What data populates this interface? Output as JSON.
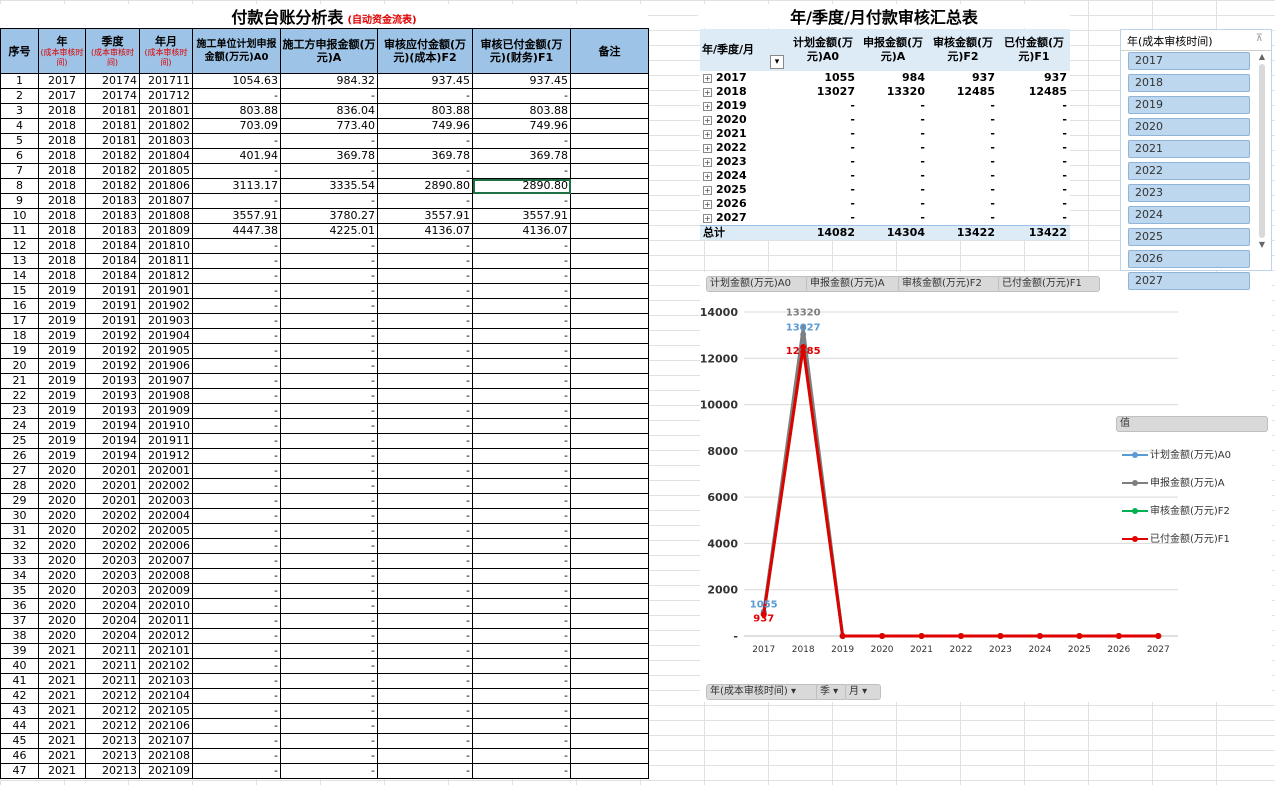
{
  "ledger": {
    "title": "付款台账分析表",
    "subtitle": "(自动资金流表)",
    "headers": {
      "seq": "序号",
      "year": "年",
      "year_sub": "(成本审核时间)",
      "quarter": "季度",
      "quarter_sub": "(成本审核时间)",
      "month": "年月",
      "month_sub": "(成本审核时间)",
      "a0": "施工单位计划申报金额(万元)A0",
      "a": "施工方申报金额(万元)A",
      "f2": "审核应付金额(万元)(成本)F2",
      "f1": "审核已付金额(万元)(财务)F1",
      "note": "备注"
    },
    "rows": [
      [
        "1",
        "2017",
        "20174",
        "201711",
        "1054.63",
        "984.32",
        "937.45",
        "937.45"
      ],
      [
        "2",
        "2017",
        "20174",
        "201712",
        "-",
        "-",
        "-",
        "-"
      ],
      [
        "3",
        "2018",
        "20181",
        "201801",
        "803.88",
        "836.04",
        "803.88",
        "803.88"
      ],
      [
        "4",
        "2018",
        "20181",
        "201802",
        "703.09",
        "773.40",
        "749.96",
        "749.96"
      ],
      [
        "5",
        "2018",
        "20181",
        "201803",
        "-",
        "-",
        "-",
        "-"
      ],
      [
        "6",
        "2018",
        "20182",
        "201804",
        "401.94",
        "369.78",
        "369.78",
        "369.78"
      ],
      [
        "7",
        "2018",
        "20182",
        "201805",
        "-",
        "-",
        "-",
        "-"
      ],
      [
        "8",
        "2018",
        "20182",
        "201806",
        "3113.17",
        "3335.54",
        "2890.80",
        "2890.80"
      ],
      [
        "9",
        "2018",
        "20183",
        "201807",
        "-",
        "-",
        "-",
        "-"
      ],
      [
        "10",
        "2018",
        "20183",
        "201808",
        "3557.91",
        "3780.27",
        "3557.91",
        "3557.91"
      ],
      [
        "11",
        "2018",
        "20183",
        "201809",
        "4447.38",
        "4225.01",
        "4136.07",
        "4136.07"
      ],
      [
        "12",
        "2018",
        "20184",
        "201810",
        "-",
        "-",
        "-",
        "-"
      ],
      [
        "13",
        "2018",
        "20184",
        "201811",
        "-",
        "-",
        "-",
        "-"
      ],
      [
        "14",
        "2018",
        "20184",
        "201812",
        "-",
        "-",
        "-",
        "-"
      ],
      [
        "15",
        "2019",
        "20191",
        "201901",
        "-",
        "-",
        "-",
        "-"
      ],
      [
        "16",
        "2019",
        "20191",
        "201902",
        "-",
        "-",
        "-",
        "-"
      ],
      [
        "17",
        "2019",
        "20191",
        "201903",
        "-",
        "-",
        "-",
        "-"
      ],
      [
        "18",
        "2019",
        "20192",
        "201904",
        "-",
        "-",
        "-",
        "-"
      ],
      [
        "19",
        "2019",
        "20192",
        "201905",
        "-",
        "-",
        "-",
        "-"
      ],
      [
        "20",
        "2019",
        "20192",
        "201906",
        "-",
        "-",
        "-",
        "-"
      ],
      [
        "21",
        "2019",
        "20193",
        "201907",
        "-",
        "-",
        "-",
        "-"
      ],
      [
        "22",
        "2019",
        "20193",
        "201908",
        "-",
        "-",
        "-",
        "-"
      ],
      [
        "23",
        "2019",
        "20193",
        "201909",
        "-",
        "-",
        "-",
        "-"
      ],
      [
        "24",
        "2019",
        "20194",
        "201910",
        "-",
        "-",
        "-",
        "-"
      ],
      [
        "25",
        "2019",
        "20194",
        "201911",
        "-",
        "-",
        "-",
        "-"
      ],
      [
        "26",
        "2019",
        "20194",
        "201912",
        "-",
        "-",
        "-",
        "-"
      ],
      [
        "27",
        "2020",
        "20201",
        "202001",
        "-",
        "-",
        "-",
        "-"
      ],
      [
        "28",
        "2020",
        "20201",
        "202002",
        "-",
        "-",
        "-",
        "-"
      ],
      [
        "29",
        "2020",
        "20201",
        "202003",
        "-",
        "-",
        "-",
        "-"
      ],
      [
        "30",
        "2020",
        "20202",
        "202004",
        "-",
        "-",
        "-",
        "-"
      ],
      [
        "31",
        "2020",
        "20202",
        "202005",
        "-",
        "-",
        "-",
        "-"
      ],
      [
        "32",
        "2020",
        "20202",
        "202006",
        "-",
        "-",
        "-",
        "-"
      ],
      [
        "33",
        "2020",
        "20203",
        "202007",
        "-",
        "-",
        "-",
        "-"
      ],
      [
        "34",
        "2020",
        "20203",
        "202008",
        "-",
        "-",
        "-",
        "-"
      ],
      [
        "35",
        "2020",
        "20203",
        "202009",
        "-",
        "-",
        "-",
        "-"
      ],
      [
        "36",
        "2020",
        "20204",
        "202010",
        "-",
        "-",
        "-",
        "-"
      ],
      [
        "37",
        "2020",
        "20204",
        "202011",
        "-",
        "-",
        "-",
        "-"
      ],
      [
        "38",
        "2020",
        "20204",
        "202012",
        "-",
        "-",
        "-",
        "-"
      ],
      [
        "39",
        "2021",
        "20211",
        "202101",
        "-",
        "-",
        "-",
        "-"
      ],
      [
        "40",
        "2021",
        "20211",
        "202102",
        "-",
        "-",
        "-",
        "-"
      ],
      [
        "41",
        "2021",
        "20211",
        "202103",
        "-",
        "-",
        "-",
        "-"
      ],
      [
        "42",
        "2021",
        "20212",
        "202104",
        "-",
        "-",
        "-",
        "-"
      ],
      [
        "43",
        "2021",
        "20212",
        "202105",
        "-",
        "-",
        "-",
        "-"
      ],
      [
        "44",
        "2021",
        "20212",
        "202106",
        "-",
        "-",
        "-",
        "-"
      ],
      [
        "45",
        "2021",
        "20213",
        "202107",
        "-",
        "-",
        "-",
        "-"
      ],
      [
        "46",
        "2021",
        "20213",
        "202108",
        "-",
        "-",
        "-",
        "-"
      ],
      [
        "47",
        "2021",
        "20213",
        "202109",
        "-",
        "-",
        "-",
        "-"
      ]
    ],
    "selected_row": 7
  },
  "summary": {
    "title": "年/季度/月付款审核汇总表",
    "headers": {
      "period": "年/季度/月",
      "a0": "计划金额(万元)A0",
      "a": "申报金额(万元)A",
      "f2": "审核金额(万元)F2",
      "f1": "已付金额(万元)F1"
    },
    "expander_glyph": "+",
    "filter_glyph": "▾",
    "rows": [
      [
        "2017",
        "1055",
        "984",
        "937",
        "937"
      ],
      [
        "2018",
        "13027",
        "13320",
        "12485",
        "12485"
      ],
      [
        "2019",
        "-",
        "-",
        "-",
        "-"
      ],
      [
        "2020",
        "-",
        "-",
        "-",
        "-"
      ],
      [
        "2021",
        "-",
        "-",
        "-",
        "-"
      ],
      [
        "2022",
        "-",
        "-",
        "-",
        "-"
      ],
      [
        "2023",
        "-",
        "-",
        "-",
        "-"
      ],
      [
        "2024",
        "-",
        "-",
        "-",
        "-"
      ],
      [
        "2025",
        "-",
        "-",
        "-",
        "-"
      ],
      [
        "2026",
        "-",
        "-",
        "-",
        "-"
      ],
      [
        "2027",
        "-",
        "-",
        "-",
        "-"
      ]
    ],
    "total": [
      "总计",
      "14082",
      "14304",
      "13422",
      "13422"
    ]
  },
  "slicer": {
    "title": "年(成本审核时间)",
    "clear_glyph": "⊼",
    "items": [
      "2017",
      "2018",
      "2019",
      "2020",
      "2021",
      "2022",
      "2023",
      "2024",
      "2025",
      "2026",
      "2027"
    ],
    "scroll_up": "▲",
    "scroll_down": "▼"
  },
  "chart_buttons": {
    "value_fields": [
      "计划金额(万元)A0",
      "申报金额(万元)A",
      "审核金额(万元)F2",
      "已付金额(万元)F1"
    ],
    "values_label": "值",
    "axis_fields": [
      "年(成本审核时间) ▾",
      "季 ▾",
      "月 ▾"
    ]
  },
  "chart_data": {
    "type": "line",
    "x": [
      "2017",
      "2018",
      "2019",
      "2020",
      "2021",
      "2022",
      "2023",
      "2024",
      "2025",
      "2026",
      "2027"
    ],
    "ylim": [
      0,
      14000
    ],
    "yticks": [
      "-",
      "2000",
      "4000",
      "6000",
      "8000",
      "10000",
      "12000",
      "14000"
    ],
    "grid": true,
    "legend": "right",
    "series": [
      {
        "name": "计划金额(万元)A0",
        "color": "#5b9bd5",
        "values": [
          1055,
          13027,
          0,
          0,
          0,
          0,
          0,
          0,
          0,
          0,
          0
        ]
      },
      {
        "name": "申报金额(万元)A",
        "color": "#7f7f7f",
        "values": [
          984,
          13320,
          0,
          0,
          0,
          0,
          0,
          0,
          0,
          0,
          0
        ]
      },
      {
        "name": "审核金额(万元)F2",
        "color": "#00b050",
        "values": [
          937,
          12485,
          0,
          0,
          0,
          0,
          0,
          0,
          0,
          0,
          0
        ]
      },
      {
        "name": "已付金额(万元)F1",
        "color": "#e00000",
        "values": [
          937,
          12485,
          0,
          0,
          0,
          0,
          0,
          0,
          0,
          0,
          0
        ]
      }
    ],
    "data_labels": [
      {
        "series": 0,
        "index": 0,
        "text": "1055"
      },
      {
        "series": 0,
        "index": 1,
        "text": "13027"
      },
      {
        "series": 1,
        "index": 1,
        "text": "13320"
      },
      {
        "series": 3,
        "index": 0,
        "text": "937"
      },
      {
        "series": 3,
        "index": 1,
        "text": "12485"
      }
    ]
  }
}
